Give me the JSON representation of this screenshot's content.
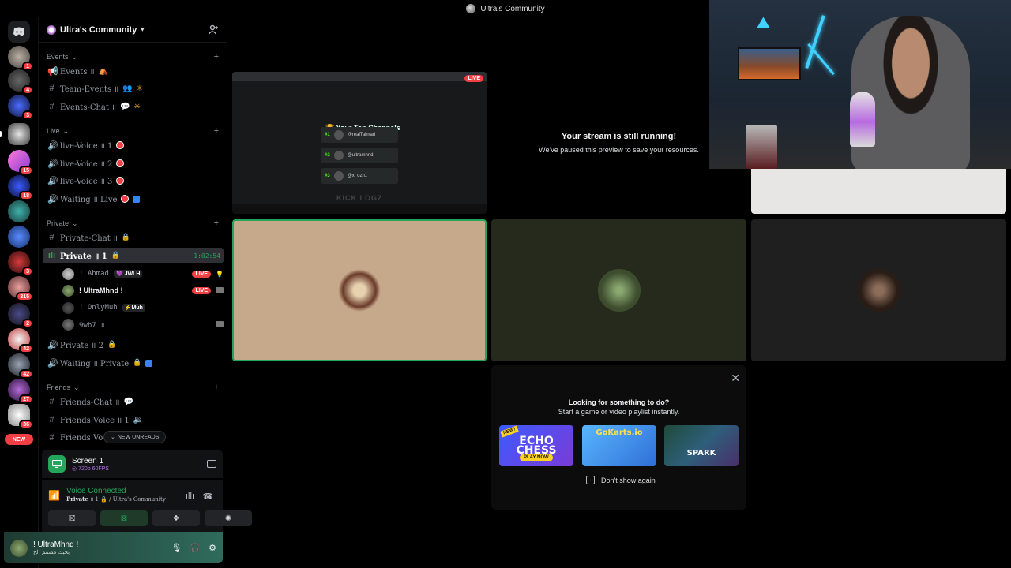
{
  "window": {
    "title": "Ultra's Community"
  },
  "rail": {
    "servers": [
      {
        "badge": "1"
      },
      {
        "badge": "4"
      },
      {
        "badge": "3"
      },
      {
        "badge": ""
      },
      {
        "badge": "15"
      },
      {
        "badge": "18"
      },
      {
        "badge": ""
      },
      {
        "badge": ""
      },
      {
        "badge": "3"
      },
      {
        "badge": "315"
      },
      {
        "badge": "2"
      },
      {
        "badge": "42"
      },
      {
        "badge": "42"
      },
      {
        "badge": "27"
      },
      {
        "badge": "36"
      }
    ],
    "new_label": "NEW"
  },
  "server": {
    "name": "Ultra's Community",
    "categories": [
      {
        "name": "Events"
      },
      {
        "name": "Live"
      },
      {
        "name": "Private"
      },
      {
        "name": "Friends"
      }
    ],
    "channels": {
      "events": "Events ॥",
      "team_events": "Team-Events ॥",
      "events_chat": "Events-Chat ॥",
      "live_voice_1": "live-Voice ॥ 1",
      "live_voice_2": "live-Voice ॥ 2",
      "live_voice_3": "live-Voice ॥ 3",
      "waiting_live": "Waiting ॥ Live",
      "private_chat": "Private-Chat ॥",
      "private_1": "Private ॥ 1",
      "private_1_timer": "1:02:54",
      "private_2": "Private ॥ 2",
      "waiting_private": "Waiting ॥ Private",
      "friends_chat": "Friends-Chat ॥",
      "friends_voice_1": "Friends Voice ॥ 1",
      "friends_voice_2": "Friends Vo"
    },
    "voice_users": [
      {
        "name": "! Ahmad",
        "tag": "JWLH",
        "live": "LIVE"
      },
      {
        "name": "! UltraMhnd !",
        "live": "LIVE"
      },
      {
        "name": "! OnlyMuh",
        "tag": "Muh"
      },
      {
        "name": "9wb7 ॥"
      }
    ],
    "new_unreads": "NEW UNREADS"
  },
  "panels": {
    "stream_title": "Screen 1",
    "stream_quality": "720p 60FPS",
    "voice_status": "Voice Connected",
    "voice_channel": "Private",
    "voice_channel_rest": "॥ 1 🔒 / Ultra's Community",
    "user_name": "! UltraMhnd !",
    "user_status": "بحبك مصمم الخ"
  },
  "stage": {
    "live_badge": "LIVE",
    "top_channels_title": "Your Top Channels",
    "top_channels": [
      {
        "rank": "#1",
        "name": "@realTalmad"
      },
      {
        "rank": "#2",
        "name": "@ultramhnd"
      },
      {
        "rank": "#3",
        "name": "@x_ozn1"
      }
    ],
    "kick_logo": "KICK LOGZ",
    "paused_title": "Your stream is still running!",
    "paused_text": "We've paused this preview to save your resources."
  },
  "activity": {
    "heading": "Looking for something to do?",
    "subheading": "Start a game or video playlist instantly.",
    "games": [
      {
        "name": "ECHO CHESS",
        "new": "NEW!",
        "cta": "PLAY NOW"
      },
      {
        "name": "GoKarts.io"
      },
      {
        "name": "SPARK"
      }
    ],
    "dont_show": "Don't show again"
  },
  "colors": {
    "accent_green": "#23a55a",
    "danger_red": "#f23f43",
    "panel_bg": "#111214"
  }
}
